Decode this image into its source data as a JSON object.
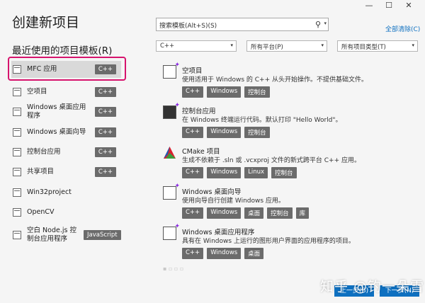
{
  "window": {
    "title": "创建新项目",
    "min": "—",
    "max": "☐",
    "close": "✕"
  },
  "recent": {
    "heading": "最近使用的项目模板(R)",
    "items": [
      {
        "label": "MFC 应用",
        "badge": "C++"
      },
      {
        "label": "空项目",
        "badge": "C++"
      },
      {
        "label": "Windows 桌面应用程序",
        "badge": "C++"
      },
      {
        "label": "Windows 桌面向导",
        "badge": "C++"
      },
      {
        "label": "控制台应用",
        "badge": "C++"
      },
      {
        "label": "共享项目",
        "badge": "C++"
      },
      {
        "label": "Win32project",
        "badge": ""
      },
      {
        "label": "OpenCV",
        "badge": ""
      },
      {
        "label": "空白 Node.js 控制台应用程序",
        "badge": "JavaScript"
      }
    ]
  },
  "search": {
    "placeholder": "搜索模板(Alt+S)(S)",
    "icon": "search-icon"
  },
  "clear_all": "全部清除(C)",
  "filters": {
    "language": "C++",
    "platform": "所有平台(P)",
    "project_type": "所有项目类型(T)"
  },
  "templates": [
    {
      "name": "空项目",
      "desc": "使用适用于 Windows 的 C++ 从头开始操作。不提供基础文件。",
      "tags": [
        "C++",
        "Windows",
        "控制台"
      ]
    },
    {
      "name": "控制台应用",
      "desc": "在 Windows 终端运行代码。默认打印 \"Hello World\"。",
      "tags": [
        "C++",
        "Windows",
        "控制台"
      ]
    },
    {
      "name": "CMake 项目",
      "desc": "生成不依赖于 .sln 或 .vcxproj 文件的新式跨平台 C++ 应用。",
      "tags": [
        "C++",
        "Windows",
        "Linux",
        "控制台"
      ]
    },
    {
      "name": "Windows 桌面向导",
      "desc": "使用向导自行创建 Windows 应用。",
      "tags": [
        "C++",
        "Windows",
        "桌面",
        "控制台",
        "库"
      ]
    },
    {
      "name": "Windows 桌面应用程序",
      "desc": "具有在 Windows 上运行的图形用户界面的应用程序的项目。",
      "tags": [
        "C++",
        "Windows",
        "桌面"
      ]
    }
  ],
  "buttons": {
    "back": "上一步(B)",
    "next": "下一步(N)"
  },
  "watermark": "知乎 @钓一朵雪"
}
